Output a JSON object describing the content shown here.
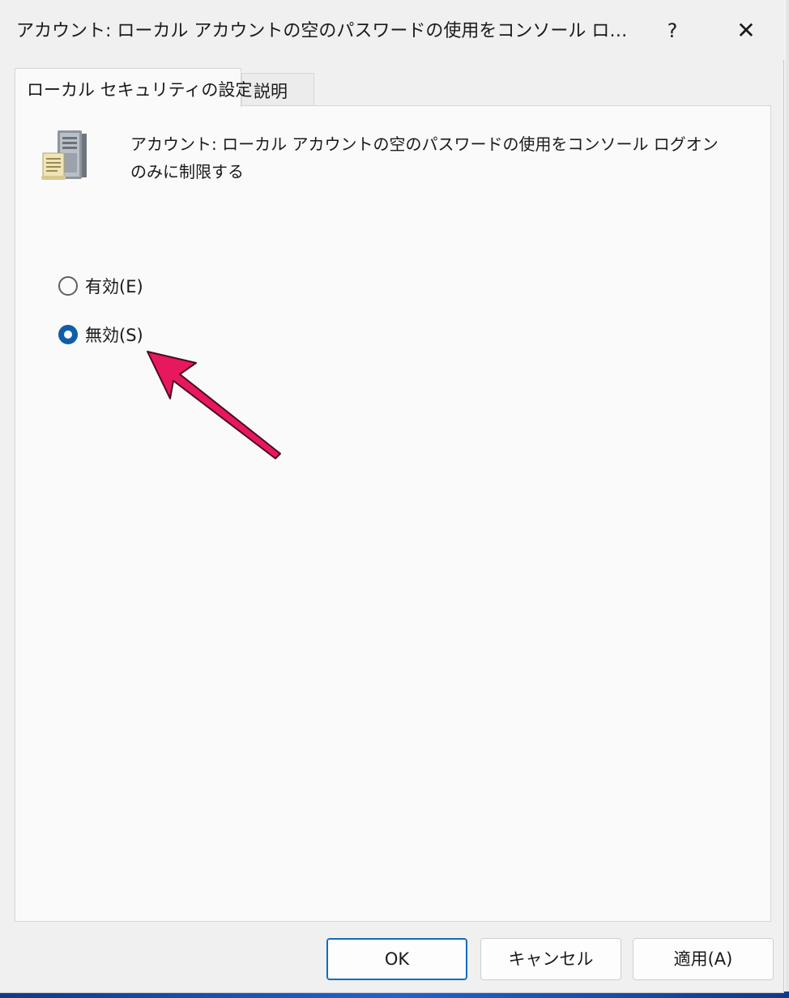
{
  "dialog": {
    "title": "アカウント: ローカル アカウントの空のパスワードの使用をコンソール ログオンのみに...",
    "help_label": "?",
    "close_label": "✕"
  },
  "tabs": [
    {
      "label": "ローカル セキュリティの設定",
      "active": true
    },
    {
      "label": "説明",
      "active": false
    }
  ],
  "policy": {
    "icon": "server-policy-icon",
    "description": "アカウント: ローカル アカウントの空のパスワードの使用をコンソール ログオンのみに制限する"
  },
  "options": {
    "enabled_label": "有効(E)",
    "disabled_label": "無効(S)",
    "selected": "disabled"
  },
  "annotation": {
    "arrow_color": "#e8185f"
  },
  "buttons": {
    "ok_label": "OK",
    "cancel_label": "キャンセル",
    "apply_label": "適用(A)"
  },
  "colors": {
    "accent": "#0f5ea8"
  }
}
